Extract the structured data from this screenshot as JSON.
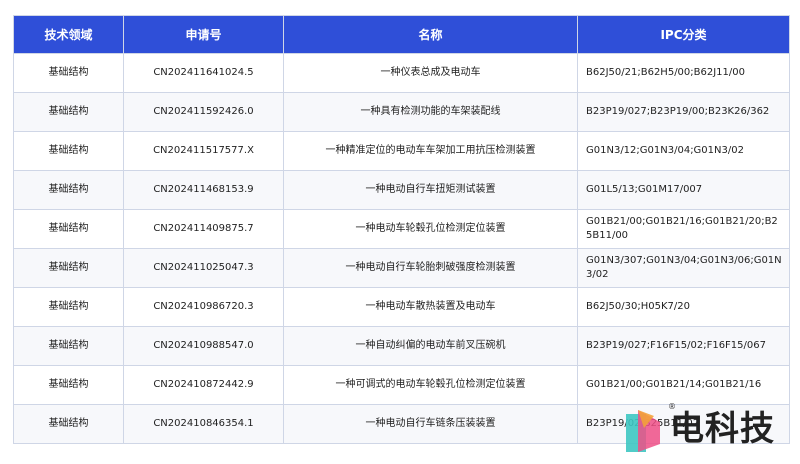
{
  "table": {
    "headers": [
      "技术领域",
      "申请号",
      "名称",
      "IPC分类"
    ],
    "rows": [
      {
        "field": "基础结构",
        "app_no": "CN202411641024.5",
        "name": "一种仪表总成及电动车",
        "ipc": "B62J50/21;B62H5/00;B62J11/00"
      },
      {
        "field": "基础结构",
        "app_no": "CN202411592426.0",
        "name": "一种具有检测功能的车架装配线",
        "ipc": "B23P19/027;B23P19/00;B23K26/362"
      },
      {
        "field": "基础结构",
        "app_no": "CN202411517577.X",
        "name": "一种精准定位的电动车车架加工用抗压检测装置",
        "ipc": "G01N3/12;G01N3/04;G01N3/02"
      },
      {
        "field": "基础结构",
        "app_no": "CN202411468153.9",
        "name": "一种电动自行车扭矩测试装置",
        "ipc": "G01L5/13;G01M17/007"
      },
      {
        "field": "基础结构",
        "app_no": "CN202411409875.7",
        "name": "一种电动车轮毂孔位检测定位装置",
        "ipc": "G01B21/00;G01B21/16;G01B21/20;B25B11/00"
      },
      {
        "field": "基础结构",
        "app_no": "CN202411025047.3",
        "name": "一种电动自行车轮胎刺破强度检测装置",
        "ipc": "G01N3/307;G01N3/04;G01N3/06;G01N3/02"
      },
      {
        "field": "基础结构",
        "app_no": "CN202410986720.3",
        "name": "一种电动车散热装置及电动车",
        "ipc": "B62J50/30;H05K7/20"
      },
      {
        "field": "基础结构",
        "app_no": "CN202410988547.0",
        "name": "一种自动纠偏的电动车前叉压碗机",
        "ipc": "B23P19/027;F16F15/02;F16F15/067"
      },
      {
        "field": "基础结构",
        "app_no": "CN202410872442.9",
        "name": "一种可调式的电动车轮毂孔位检测定位装置",
        "ipc": "G01B21/00;G01B21/14;G01B21/16"
      },
      {
        "field": "基础结构",
        "app_no": "CN202410846354.1",
        "name": "一种电动自行车链条压装装置",
        "ipc": "B23P19/02;B25B11/02"
      }
    ]
  },
  "watermark": {
    "text": "电科技",
    "reg_mark": "®"
  },
  "colors": {
    "header_bg": "#2f4fd8",
    "header_text": "#ffffff",
    "border": "#cfd6e6",
    "logo_teal": "#3dc7c2",
    "logo_pink": "#ef4f86",
    "logo_orange": "#f3a23a"
  }
}
